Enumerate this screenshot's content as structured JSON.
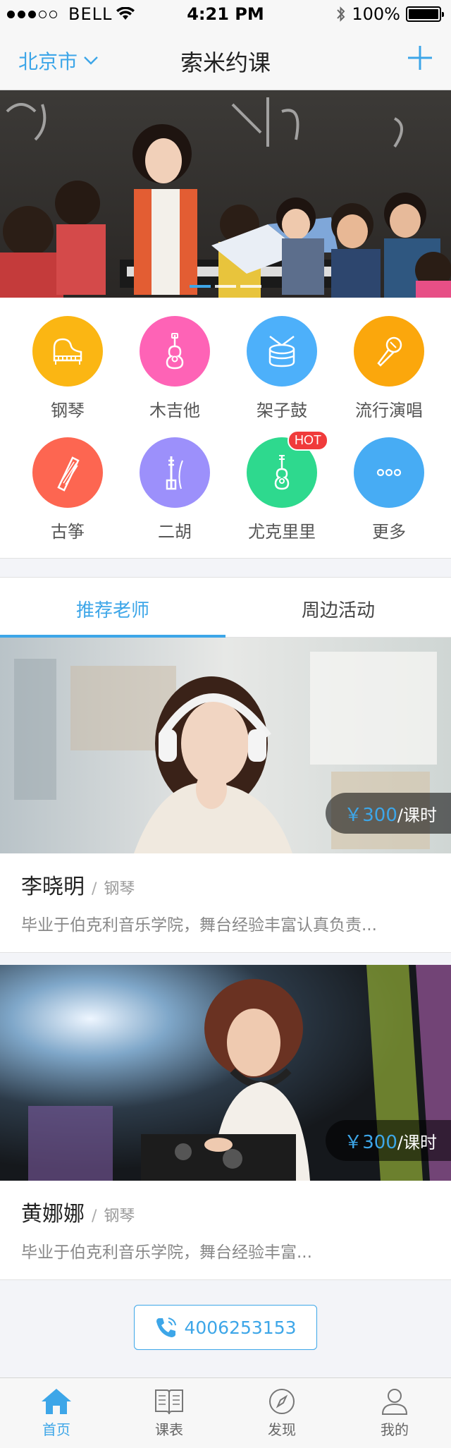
{
  "status_bar": {
    "carrier": "BELL",
    "time": "4:21 PM",
    "battery": "100%",
    "battery_level": 1.0
  },
  "nav": {
    "city": "北京市",
    "title": "索米约课",
    "add_icon": "plus-icon"
  },
  "banner": {
    "page_count": 3,
    "active_index": 0
  },
  "categories": [
    {
      "label": "钢琴",
      "color": "#fbb613",
      "icon": "piano-icon"
    },
    {
      "label": "木吉他",
      "color": "#fe63b6",
      "icon": "guitar-icon"
    },
    {
      "label": "架子鼓",
      "color": "#4db0fa",
      "icon": "drum-icon"
    },
    {
      "label": "流行演唱",
      "color": "#fba70c",
      "icon": "microphone-icon"
    },
    {
      "label": "古筝",
      "color": "#fd6651",
      "icon": "guzheng-icon"
    },
    {
      "label": "二胡",
      "color": "#9c90fb",
      "icon": "erhu-icon"
    },
    {
      "label": "尤克里里",
      "color": "#2ed98e",
      "icon": "ukulele-icon",
      "badge": "HOT"
    },
    {
      "label": "更多",
      "color": "#47acf4",
      "icon": "more-icon"
    }
  ],
  "tabs": [
    {
      "label": "推荐老师",
      "active": true
    },
    {
      "label": "周边活动",
      "active": false
    }
  ],
  "teachers": [
    {
      "name": "李晓明",
      "separator": "/",
      "instrument": "钢琴",
      "price_symbol": "￥",
      "price": "300",
      "unit": "/课时",
      "desc": "毕业于伯克利音乐学院，舞台经验丰富认真负责..."
    },
    {
      "name": "黄娜娜",
      "separator": "/",
      "instrument": "钢琴",
      "price_symbol": "￥",
      "price": "300",
      "unit": "/课时",
      "desc": "毕业于伯克利音乐学院，舞台经验丰富..."
    }
  ],
  "phone": {
    "number": "4006253153"
  },
  "tabbar": [
    {
      "label": "首页",
      "icon": "home-icon",
      "active": true
    },
    {
      "label": "课表",
      "icon": "schedule-icon",
      "active": false
    },
    {
      "label": "发现",
      "icon": "compass-icon",
      "active": false
    },
    {
      "label": "我的",
      "icon": "user-icon",
      "active": false
    }
  ],
  "colors": {
    "accent": "#3da6e8",
    "hot_badge": "#f03b3b"
  }
}
